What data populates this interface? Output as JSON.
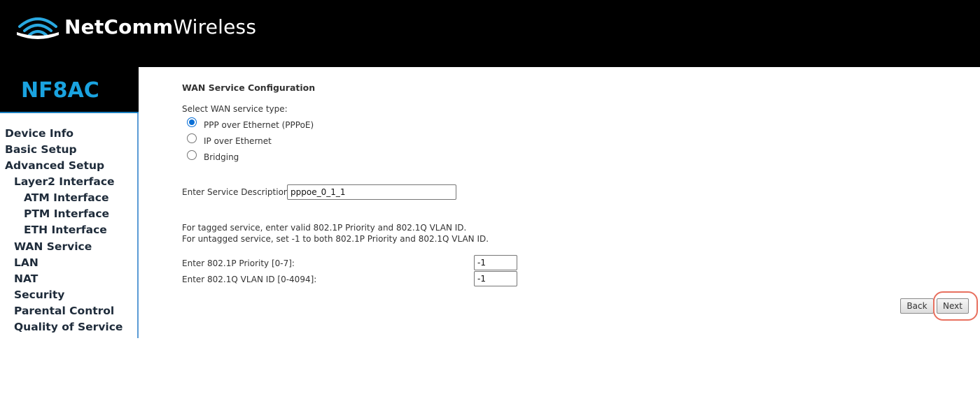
{
  "header": {
    "brand_bold": "NetComm",
    "brand_light": "Wireless",
    "logo_icon": "wifi-logo-icon"
  },
  "sidebar": {
    "model": "NF8AC",
    "items": [
      {
        "label": "Device Info",
        "level": 0
      },
      {
        "label": "Basic Setup",
        "level": 0
      },
      {
        "label": "Advanced Setup",
        "level": 0
      },
      {
        "label": "Layer2 Interface",
        "level": 1
      },
      {
        "label": "ATM Interface",
        "level": 2
      },
      {
        "label": "PTM Interface",
        "level": 2
      },
      {
        "label": "ETH Interface",
        "level": 2
      },
      {
        "label": "WAN Service",
        "level": 1
      },
      {
        "label": "LAN",
        "level": 1
      },
      {
        "label": "NAT",
        "level": 1
      },
      {
        "label": "Security",
        "level": 1
      },
      {
        "label": "Parental Control",
        "level": 1
      },
      {
        "label": "Quality of Service",
        "level": 1
      }
    ]
  },
  "main": {
    "title": "WAN Service Configuration",
    "select_label": "Select WAN service type:",
    "service_types": [
      {
        "label": "PPP over Ethernet (PPPoE)",
        "selected": true
      },
      {
        "label": "IP over Ethernet",
        "selected": false
      },
      {
        "label": "Bridging",
        "selected": false
      }
    ],
    "description_label": "Enter Service Description:",
    "description_value": "pppoe_0_1_1",
    "vlan_note_1": "For tagged service, enter valid 802.1P Priority and 802.1Q VLAN ID.",
    "vlan_note_2": "For untagged service, set -1 to both 802.1P Priority and 802.1Q VLAN ID.",
    "priority_label": "Enter 802.1P Priority [0-7]:",
    "priority_value": "-1",
    "vlan_id_label": "Enter 802.1Q VLAN ID [0-4094]:",
    "vlan_id_value": "-1",
    "back_label": "Back",
    "next_label": "Next"
  },
  "colors": {
    "header_bg": "#000000",
    "model_text": "#1aa3e0",
    "highlight_ring": "#e8705f",
    "radio_selected": "#0a6fd6"
  }
}
